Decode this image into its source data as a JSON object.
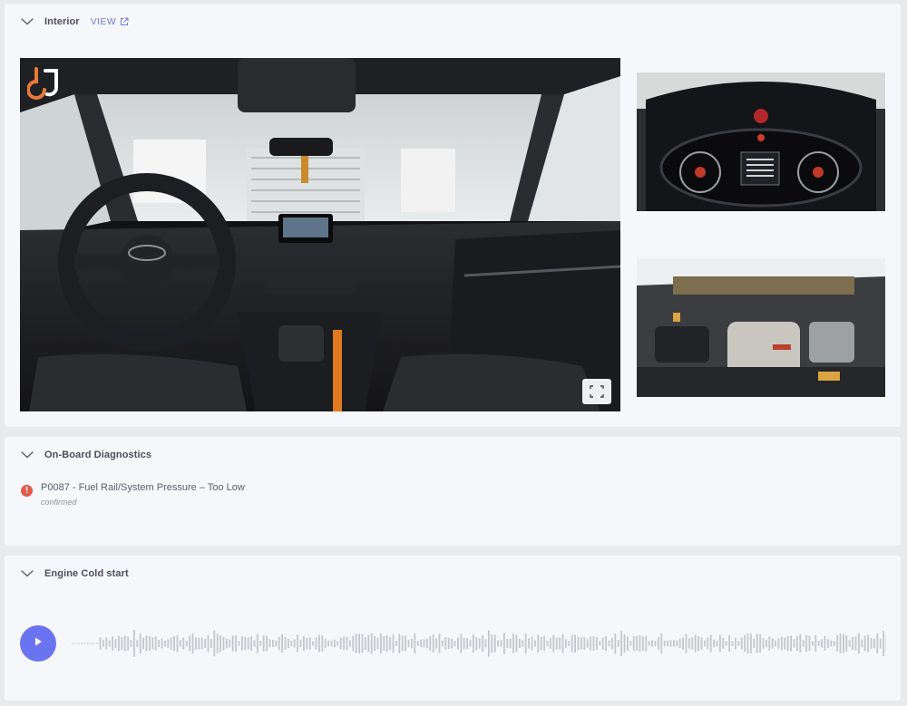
{
  "sections": {
    "interior": {
      "title": "Interior",
      "view_label": "VIEW"
    },
    "obd": {
      "title": "On-Board Diagnostics",
      "codes": [
        {
          "code": "P0087 - Fuel Rail/System Pressure – Too Low",
          "status": "confirmed"
        }
      ]
    },
    "cold_start": {
      "title": "Engine Cold start"
    }
  },
  "icons": {
    "collapse": "chevron-down-icon",
    "external": "external-link-icon",
    "fullscreen": "fullscreen-icon",
    "play": "play-icon",
    "alert": "alert-circle-icon"
  },
  "colors": {
    "accent": "#6b74f0",
    "link": "#6f7bd6",
    "error": "#e05a4a",
    "logo": "#e8793a"
  }
}
